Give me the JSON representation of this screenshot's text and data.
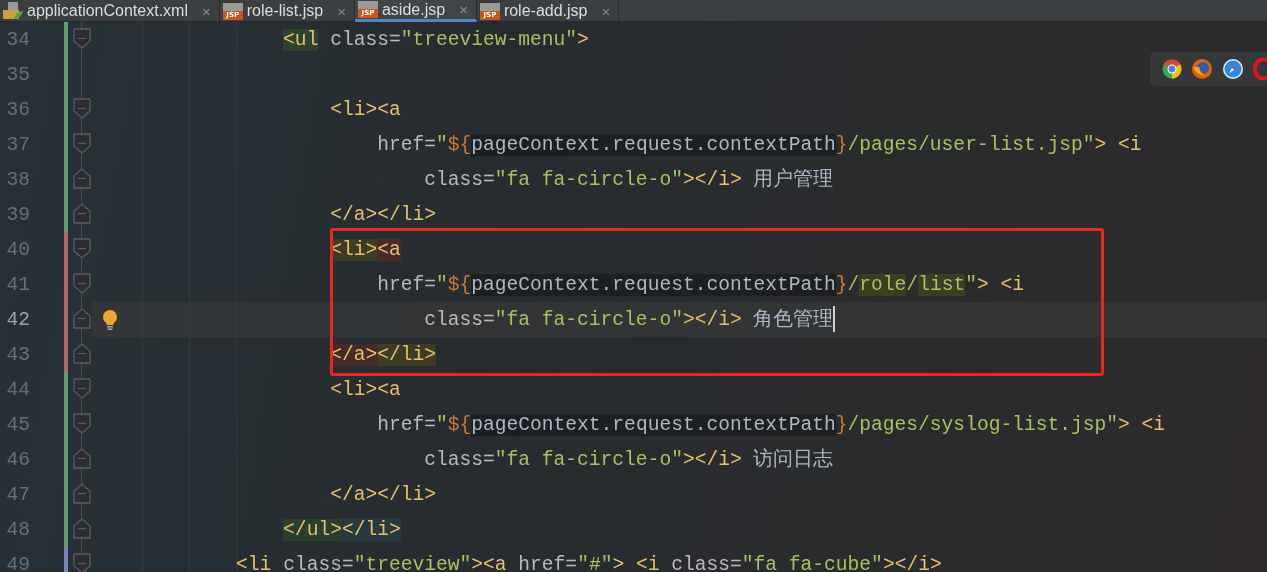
{
  "tabs": [
    {
      "label": "applicationContext.xml",
      "kind": "xml",
      "close_icon": "×",
      "selected": false
    },
    {
      "label": "role-list.jsp",
      "kind": "jsp",
      "badge": "JSP",
      "close_icon": "×",
      "selected": false
    },
    {
      "label": "aside.jsp",
      "kind": "jsp",
      "badge": "JSP",
      "close_icon": "×",
      "selected": true
    },
    {
      "label": "role-add.jsp",
      "kind": "jsp",
      "badge": "JSP",
      "close_icon": "×",
      "selected": false
    }
  ],
  "editor": {
    "lines": [
      {
        "number": "34",
        "color": "#5f9e6a",
        "fold_start": true,
        "fold_end": false,
        "current": false,
        "boxed": false,
        "tokens": [
          {
            "text": "            <ul",
            "kind": "tag",
            "color": "#2d4330"
          },
          {
            "text": " class=",
            "kind": "attr"
          },
          {
            "text": "\"treeview-menu\"",
            "kind": "string"
          },
          {
            "text": ">",
            "kind": "tag"
          }
        ]
      },
      {
        "number": "35",
        "color": "#5f9e6a",
        "fold_start": false,
        "fold_end": false,
        "current": false,
        "boxed": false
      },
      {
        "number": "36",
        "color": "#5f9e6a",
        "fold_start": true,
        "fold_end": false,
        "current": false,
        "boxed": false,
        "tokens": [
          {
            "text": "                <li><a",
            "kind": "tag"
          }
        ]
      },
      {
        "number": "37",
        "color": "#5f9e6a",
        "fold_start": true,
        "fold_end": false,
        "current": false,
        "boxed": false,
        "tokens": [
          {
            "text": "                    href=",
            "kind": "attr"
          },
          {
            "text": "\"",
            "kind": "string"
          },
          {
            "text": "${",
            "kind": "expr"
          },
          {
            "text": "pageContext.request.contextPath",
            "kind": "inject"
          },
          {
            "text": "}",
            "kind": "expr"
          },
          {
            "text": "/pages/user-list.jsp\"",
            "kind": "string"
          },
          {
            "text": "> <i",
            "kind": "tag"
          }
        ]
      },
      {
        "number": "38",
        "color": "#5f9e6a",
        "fold_start": false,
        "fold_end": true,
        "current": false,
        "boxed": false,
        "tokens": [
          {
            "text": "                        class=",
            "kind": "attr"
          },
          {
            "text": "\"fa fa-circle-o\"",
            "kind": "string"
          },
          {
            "text": "></i>",
            "kind": "tag"
          },
          {
            "text": " 用户管理",
            "kind": "text"
          }
        ]
      },
      {
        "number": "39",
        "color": "#5f9e6a",
        "fold_start": false,
        "fold_end": true,
        "current": false,
        "boxed": false,
        "tokens": [
          {
            "text": "                </a></li>",
            "kind": "tag"
          }
        ]
      },
      {
        "number": "40",
        "color": "#b06868",
        "fold_start": true,
        "fold_end": false,
        "current": false,
        "boxed": true,
        "tokens": [
          {
            "text": "                <li>",
            "kind": "tag",
            "color": "#3d3d26"
          },
          {
            "text": "<a",
            "kind": "tag",
            "color": "#472b2b"
          }
        ]
      },
      {
        "number": "41",
        "color": "#b06868",
        "fold_start": true,
        "fold_end": false,
        "current": false,
        "boxed": true,
        "tokens": [
          {
            "text": "                    href=",
            "kind": "attr"
          },
          {
            "text": "\"",
            "kind": "string"
          },
          {
            "text": "${",
            "kind": "expr"
          },
          {
            "text": "pageContext.request.contextPath",
            "kind": "inject"
          },
          {
            "text": "}",
            "kind": "expr"
          },
          {
            "text": "/",
            "kind": "string"
          },
          {
            "text": "role",
            "kind": "string",
            "color": "#3d3d26"
          },
          {
            "text": "/",
            "kind": "string"
          },
          {
            "text": "list",
            "kind": "string",
            "color": "#3d3d26"
          },
          {
            "text": "\"",
            "kind": "string"
          },
          {
            "text": "> <i",
            "kind": "tag"
          }
        ]
      },
      {
        "number": "42",
        "color": "#b06868",
        "fold_start": false,
        "fold_end": true,
        "current": true,
        "boxed": true,
        "tokens": [
          {
            "text": "                        class=",
            "kind": "attr"
          },
          {
            "text": "\"fa fa-circle-o\"",
            "kind": "string"
          },
          {
            "text": "></i>",
            "kind": "tag"
          },
          {
            "text": " 角色管理",
            "kind": "text"
          }
        ]
      },
      {
        "number": "43",
        "color": "#b06868",
        "fold_start": false,
        "fold_end": true,
        "current": false,
        "boxed": true,
        "tokens": [
          {
            "text": "                </a>",
            "kind": "tag",
            "color": "#472b2b"
          },
          {
            "text": "</li>",
            "kind": "tag",
            "color": "#3d3d26"
          }
        ]
      },
      {
        "number": "44",
        "color": "#5f9e6a",
        "fold_start": true,
        "fold_end": false,
        "current": false,
        "boxed": false,
        "tokens": [
          {
            "text": "                <li><a",
            "kind": "tag"
          }
        ]
      },
      {
        "number": "45",
        "color": "#5f9e6a",
        "fold_start": true,
        "fold_end": false,
        "current": false,
        "boxed": false,
        "tokens": [
          {
            "text": "                    href=",
            "kind": "attr"
          },
          {
            "text": "\"",
            "kind": "string"
          },
          {
            "text": "${",
            "kind": "expr"
          },
          {
            "text": "pageContext.request.contextPath",
            "kind": "inject"
          },
          {
            "text": "}",
            "kind": "expr"
          },
          {
            "text": "/pages/syslog-list.jsp\"",
            "kind": "string"
          },
          {
            "text": "> <i",
            "kind": "tag"
          }
        ]
      },
      {
        "number": "46",
        "color": "#5f9e6a",
        "fold_start": false,
        "fold_end": true,
        "current": false,
        "boxed": false,
        "tokens": [
          {
            "text": "                        class=",
            "kind": "attr"
          },
          {
            "text": "\"fa fa-circle-o\"",
            "kind": "string"
          },
          {
            "text": "></i>",
            "kind": "tag"
          },
          {
            "text": " 访问日志",
            "kind": "text"
          }
        ]
      },
      {
        "number": "47",
        "color": "#5f9e6a",
        "fold_start": false,
        "fold_end": true,
        "current": false,
        "boxed": false,
        "tokens": [
          {
            "text": "                </a></li>",
            "kind": "tag"
          }
        ]
      },
      {
        "number": "48",
        "color": "#5f9e6a",
        "fold_start": false,
        "fold_end": true,
        "current": false,
        "boxed": false,
        "tokens": [
          {
            "text": "            </ul>",
            "kind": "tag",
            "color": "#2a402e"
          },
          {
            "text": "</li>",
            "kind": "tag",
            "color": "#273a40"
          }
        ]
      },
      {
        "number": "49",
        "color": "#7d7fbf",
        "fold_start": true,
        "fold_end": false,
        "current": false,
        "boxed": false,
        "tokens": [
          {
            "text": "        <li",
            "kind": "tag"
          },
          {
            "text": " class=",
            "kind": "attr"
          },
          {
            "text": "\"treeview\"",
            "kind": "string"
          },
          {
            "text": "><a",
            "kind": "tag"
          },
          {
            "text": " href=",
            "kind": "attr"
          },
          {
            "text": "\"#\"",
            "kind": "string"
          },
          {
            "text": "> <i",
            "kind": "tag"
          },
          {
            "text": " class=",
            "kind": "attr"
          },
          {
            "text": "\"fa fa-cube\"",
            "kind": "string"
          },
          {
            "text": "></i>",
            "kind": "tag"
          }
        ]
      }
    ]
  }
}
